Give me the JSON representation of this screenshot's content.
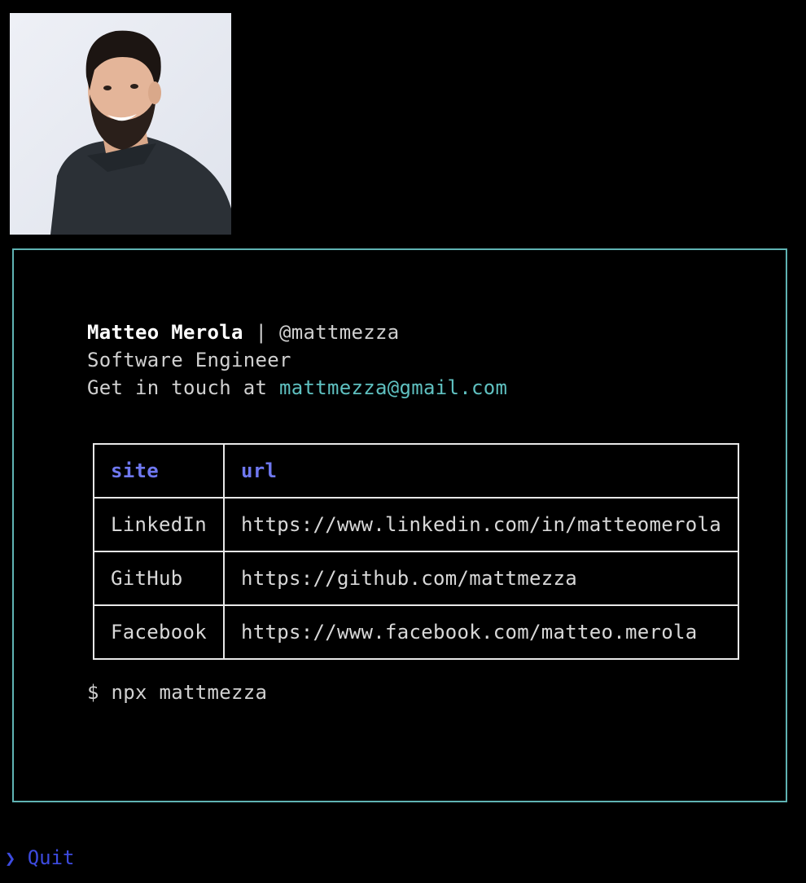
{
  "profile": {
    "name": "Matteo Merola",
    "separator": " | ",
    "handle": "@mattmezza",
    "title": "Software Engineer",
    "contact_prefix": "Get in touch at ",
    "email": "mattmezza@gmail.com"
  },
  "table": {
    "headers": [
      "site",
      "url"
    ],
    "rows": [
      {
        "site": "LinkedIn",
        "url": "https://www.linkedin.com/in/matteomerola"
      },
      {
        "site": "GitHub",
        "url": "https://github.com/mattmezza"
      },
      {
        "site": "Facebook",
        "url": "https://www.facebook.com/matteo.merola"
      }
    ]
  },
  "command": "$ npx mattmezza",
  "menu": {
    "chevron": "❯",
    "quit_label": "Quit"
  },
  "colors": {
    "border": "#5fb3b3",
    "email": "#5fc0c0",
    "header": "#6f78f0",
    "quit": "#3d4be0"
  }
}
